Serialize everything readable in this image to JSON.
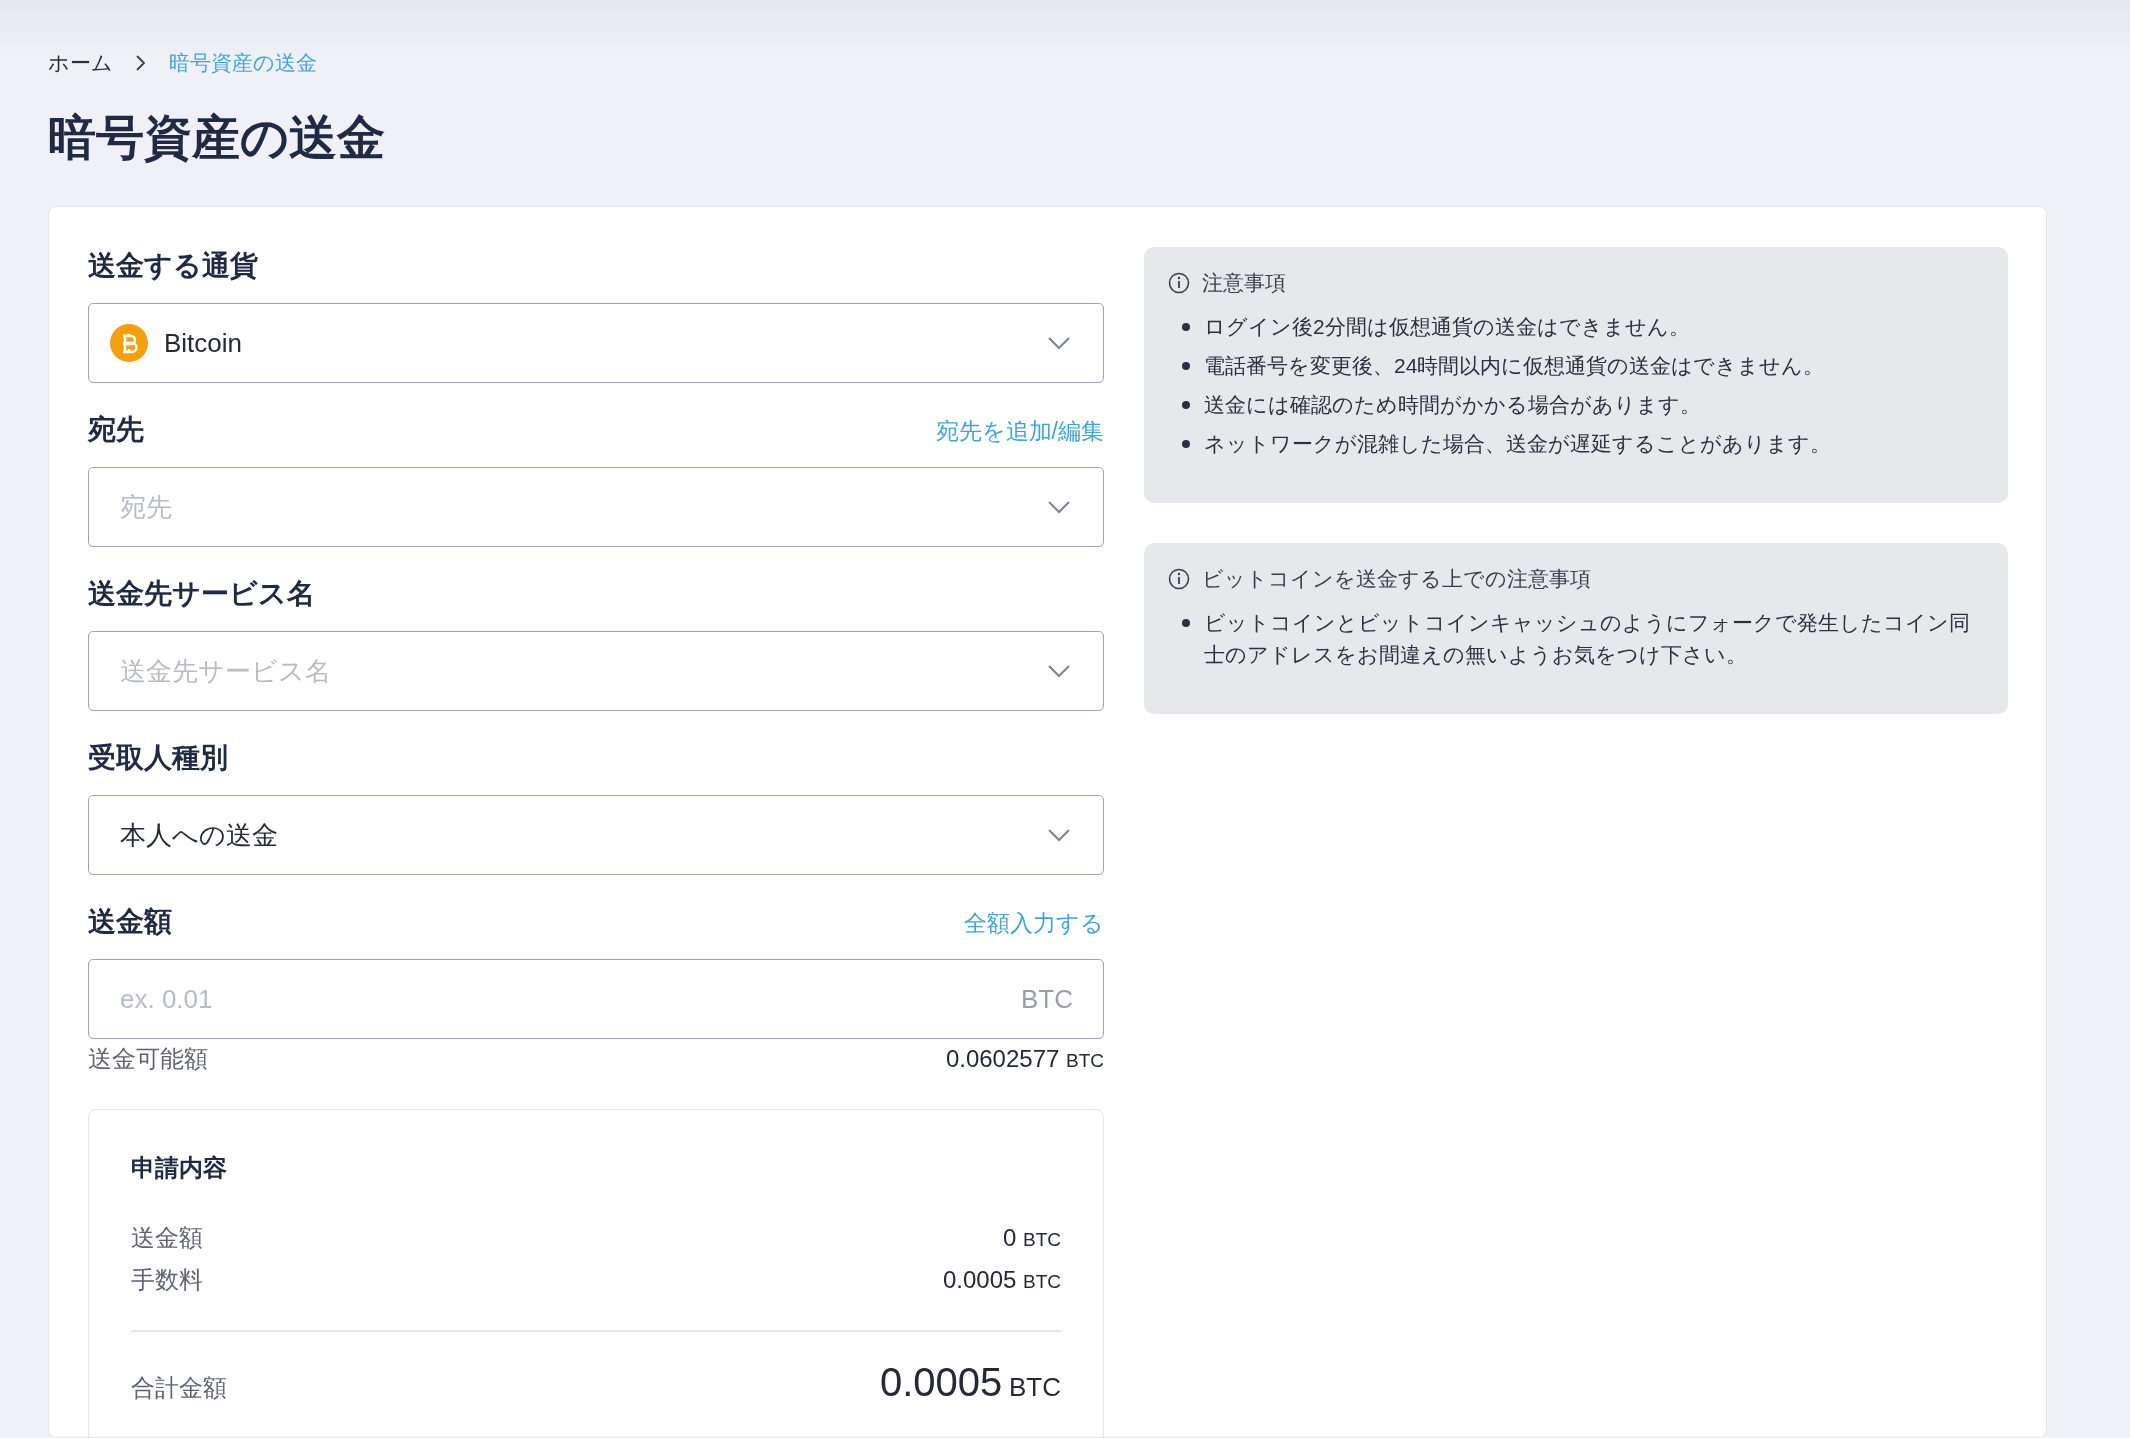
{
  "breadcrumb": [
    {
      "label": "ホーム",
      "current": false
    },
    {
      "label": "暗号資産の送金",
      "current": true
    }
  ],
  "title": "暗号資産の送金",
  "fields": [
    {
      "kind": "currency",
      "label": "送金する通貨",
      "value": "Bitcoin"
    },
    {
      "kind": "select",
      "label": "宛先",
      "link": "宛先を追加/編集",
      "placeholder": "宛先"
    },
    {
      "kind": "select",
      "label": "送金先サービス名",
      "placeholder": "送金先サービス名"
    },
    {
      "kind": "select",
      "label": "受取人種別",
      "value": "本人への送金"
    },
    {
      "kind": "amount",
      "label": "送金額",
      "link": "全額入力する",
      "placeholder": "ex. 0.01",
      "unit": "BTC"
    }
  ],
  "available": {
    "label": "送金可能額",
    "amount": "0.0602577",
    "unit": "BTC"
  },
  "summary": {
    "title": "申請内容",
    "rows": [
      {
        "label": "送金額",
        "amount": "0",
        "unit": "BTC"
      },
      {
        "label": "手数料",
        "amount": "0.0005",
        "unit": "BTC"
      }
    ],
    "total": {
      "label": "合計金額",
      "amount": "0.0005",
      "unit": "BTC"
    }
  },
  "notices": [
    {
      "title": "注意事項",
      "items": [
        "ログイン後2分間は仮想通貨の送金はできません。",
        "電話番号を変更後、24時間以内に仮想通貨の送金はできません。",
        "送金には確認のため時間がかかる場合があります。",
        "ネットワークが混雑した場合、送金が遅延することがあります。"
      ]
    },
    {
      "title": "ビットコインを送金する上での注意事項",
      "items": [
        "ビットコインとビットコインキャッシュのようにフォークで発生したコイン同士のアドレスをお間違えの無いようお気をつけ下さい。"
      ]
    }
  ]
}
